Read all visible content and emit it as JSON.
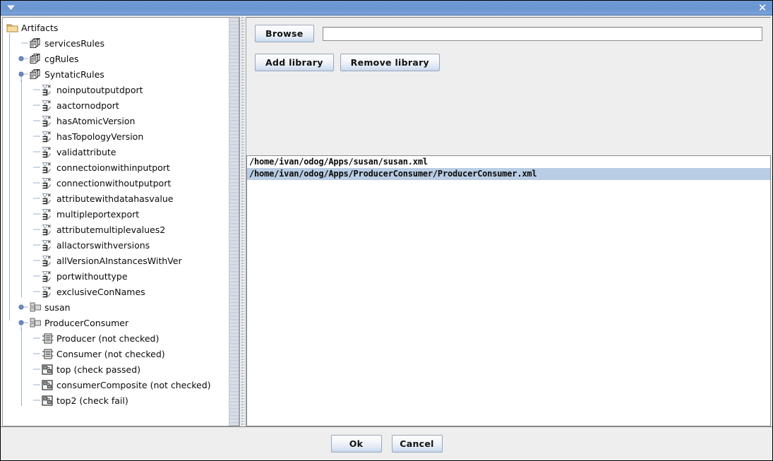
{
  "window": {
    "title": "",
    "menu_arrow_icon": "chevron-down-icon",
    "close_label": "✕"
  },
  "tree": {
    "root": "Artifacts",
    "nodes": [
      {
        "label": "Artifacts",
        "depth": 0,
        "icon": "folder-icon",
        "handle": "none"
      },
      {
        "label": "servicesRules",
        "depth": 1,
        "icon": "rule-set-icon",
        "handle": "leaf"
      },
      {
        "label": "cgRules",
        "depth": 1,
        "icon": "rule-set-icon",
        "handle": "collapsed"
      },
      {
        "label": "SyntaticRules",
        "depth": 1,
        "icon": "rule-set-icon",
        "handle": "expanded"
      },
      {
        "label": "noinputoutputdport",
        "depth": 2,
        "icon": "rule-icon",
        "handle": "leaf"
      },
      {
        "label": "aactornodport",
        "depth": 2,
        "icon": "rule-icon",
        "handle": "leaf"
      },
      {
        "label": "hasAtomicVersion",
        "depth": 2,
        "icon": "rule-icon",
        "handle": "leaf"
      },
      {
        "label": "hasTopologyVersion",
        "depth": 2,
        "icon": "rule-icon",
        "handle": "leaf"
      },
      {
        "label": "validattribute",
        "depth": 2,
        "icon": "rule-icon",
        "handle": "leaf"
      },
      {
        "label": "connectoionwithinputport",
        "depth": 2,
        "icon": "rule-icon",
        "handle": "leaf"
      },
      {
        "label": "connectionwithoutputport",
        "depth": 2,
        "icon": "rule-icon",
        "handle": "leaf"
      },
      {
        "label": "attributewithdatahasvalue",
        "depth": 2,
        "icon": "rule-icon",
        "handle": "leaf"
      },
      {
        "label": "multipleportexport",
        "depth": 2,
        "icon": "rule-icon",
        "handle": "leaf"
      },
      {
        "label": "attributemultiplevalues2",
        "depth": 2,
        "icon": "rule-icon",
        "handle": "leaf"
      },
      {
        "label": "allactorswithversions",
        "depth": 2,
        "icon": "rule-icon",
        "handle": "leaf"
      },
      {
        "label": "allVersionAInstancesWithVer",
        "depth": 2,
        "icon": "rule-icon",
        "handle": "leaf"
      },
      {
        "label": "portwithouttype",
        "depth": 2,
        "icon": "rule-icon",
        "handle": "leaf"
      },
      {
        "label": "exclusiveConNames",
        "depth": 2,
        "icon": "rule-icon",
        "handle": "leaf"
      },
      {
        "label": "susan",
        "depth": 1,
        "icon": "package-icon",
        "handle": "collapsed"
      },
      {
        "label": "ProducerConsumer",
        "depth": 1,
        "icon": "package-icon",
        "handle": "expanded"
      },
      {
        "label": "Producer (not checked)",
        "depth": 2,
        "icon": "component-icon",
        "handle": "leaf"
      },
      {
        "label": "Consumer (not checked)",
        "depth": 2,
        "icon": "component-icon",
        "handle": "leaf"
      },
      {
        "label": "top (check passed)",
        "depth": 2,
        "icon": "composite-icon",
        "handle": "leaf"
      },
      {
        "label": "consumerComposite (not checked)",
        "depth": 2,
        "icon": "composite-icon",
        "handle": "leaf"
      },
      {
        "label": "top2 (check fail)",
        "depth": 2,
        "icon": "composite-icon",
        "handle": "leaf"
      }
    ]
  },
  "toolbar": {
    "browse_label": "Browse",
    "path_value": "",
    "path_placeholder": "",
    "add_library_label": "Add library",
    "remove_library_label": "Remove library"
  },
  "library_list": {
    "items": [
      {
        "path": "/home/ivan/odog/Apps/susan/susan.xml",
        "selected": false
      },
      {
        "path": "/home/ivan/odog/Apps/ProducerConsumer/ProducerConsumer.xml",
        "selected": true
      }
    ]
  },
  "footer": {
    "ok_label": "Ok",
    "cancel_label": "Cancel"
  },
  "colors": {
    "titlebar": "#6f9ad6",
    "selection": "#b9cde4",
    "panel_bg": "#eeeeee",
    "folder": "#e8c86a"
  }
}
